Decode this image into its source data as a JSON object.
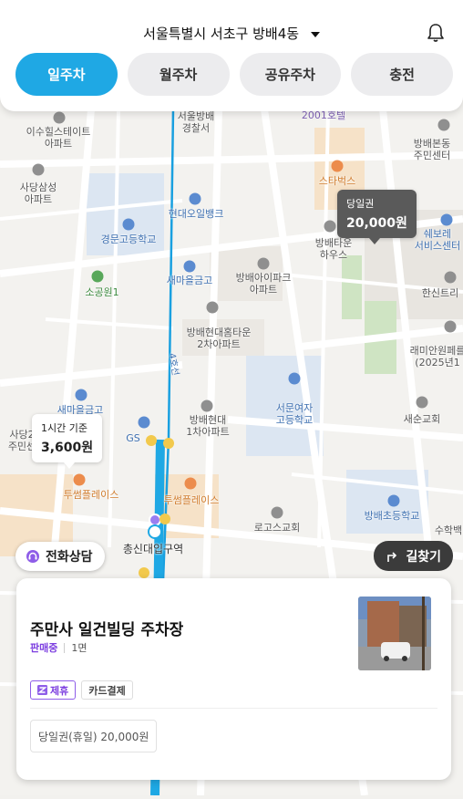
{
  "header": {
    "location": "서울특별시 서초구 방배4동",
    "tabs": [
      {
        "label": "일주차",
        "active": true
      },
      {
        "label": "월주차",
        "active": false
      },
      {
        "label": "공유주차",
        "active": false
      },
      {
        "label": "충전",
        "active": false
      }
    ]
  },
  "map": {
    "labels": {
      "isu_hillstate": "이수힐스테이트\n아파트",
      "sadang_samsung": "사당삼성\n아파트",
      "kyungmun_hs": "경문고등학교",
      "sogong": "소공원1",
      "hyundai_oil": "현대오일뱅크",
      "saemaul_1": "새마을금고",
      "saemaul_2": "새마을금고",
      "bangbae_police": "서울방배\n경찰서",
      "hotel_2001": "2001호텔",
      "starbucks": "스타벅스",
      "bangbae_center": "방배본동\n주민센터",
      "bangbae_town": "방배타운\n하우스",
      "shebore": "쉐보레\n서비스센터",
      "bangbae_ipark": "방배아이파크\n아파트",
      "hanshin": "한신트리",
      "hyundai_home": "방배현대홈타운\n2차아파트",
      "raemian": "래미안원페를\n(2025년1",
      "seomun_girls": "서문여자\n고등학교",
      "saesun_church": "새순교회",
      "hyundai_1": "방배현대\n1차아파트",
      "sadang_center": "사당2\n주민센",
      "gs": "GS",
      "twosome_1": "투썸플레이스",
      "twosome_2": "투썸플레이스",
      "chongshin_station": "총신대입구역",
      "rogos_church": "로고스교회",
      "bangbae_es": "방배초등학교",
      "suhak": "수학백",
      "line4": "4호선"
    },
    "bubbles": {
      "day_pass": {
        "label": "당일권",
        "price": "20,000원"
      },
      "hourly": {
        "label": "1시간 기준",
        "price": "3,600원"
      }
    }
  },
  "buttons": {
    "call": "전화상담",
    "route": "길찾기"
  },
  "lot": {
    "name": "주만사 일건빌딩 주차장",
    "status": "판매중",
    "floor": "1면",
    "tags": [
      "제휴",
      "카드결제"
    ],
    "price": "당일권(휴일) 20,000원"
  },
  "colors": {
    "accent": "#1fa8e4",
    "status_purple": "#7d3fe0",
    "subway_line4": "#19a0e0"
  }
}
